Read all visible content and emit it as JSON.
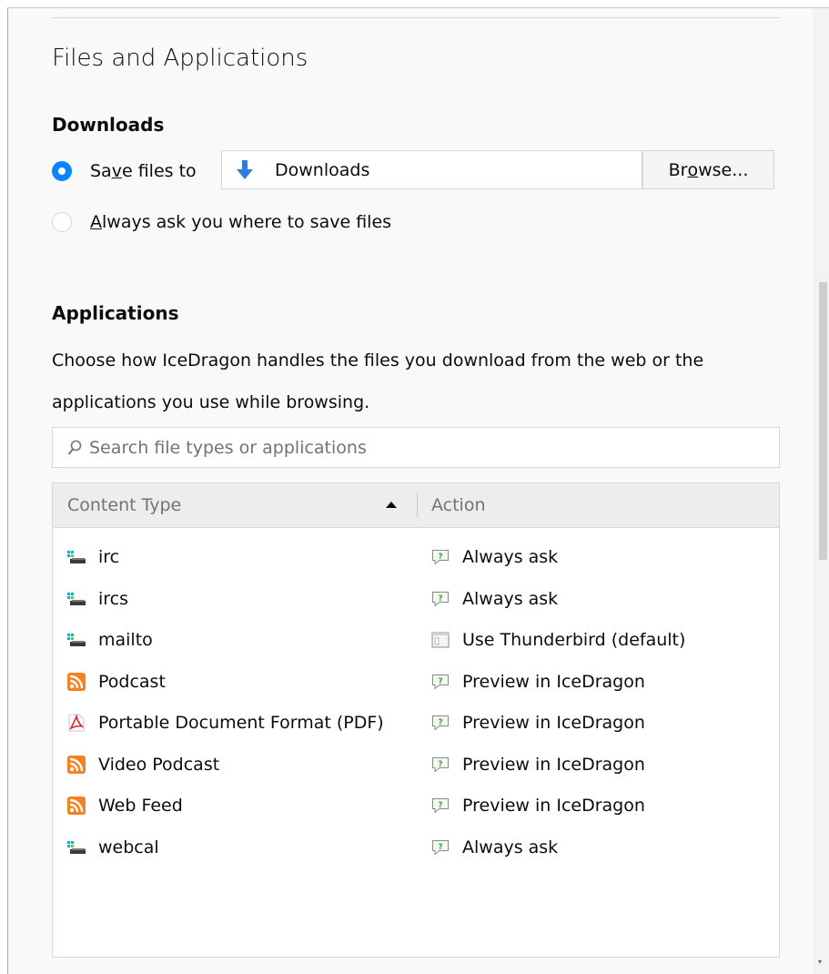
{
  "section_title": "Files and Applications",
  "downloads": {
    "heading": "Downloads",
    "save_option": {
      "pre": "Sa",
      "accel": "v",
      "post": "e files to",
      "checked": true
    },
    "folder_name": "Downloads",
    "browse": {
      "pre": "Br",
      "accel": "o",
      "post": "wse..."
    },
    "ask_option": {
      "accel": "A",
      "post": "lways ask you where to save files",
      "checked": false
    }
  },
  "applications": {
    "heading": "Applications",
    "description_line1": "Choose how IceDragon handles the files you download from the web or the",
    "description_line2": "applications you use while browsing.",
    "search_placeholder": "Search file types or applications",
    "columns": {
      "content_type": "Content Type",
      "action": "Action"
    },
    "rows": [
      {
        "type": "irc",
        "type_icon": "network-icon",
        "action": "Always ask",
        "action_icon": "ask-icon"
      },
      {
        "type": "ircs",
        "type_icon": "network-icon",
        "action": "Always ask",
        "action_icon": "ask-icon"
      },
      {
        "type": "mailto",
        "type_icon": "network-icon",
        "action": "Use Thunderbird (default)",
        "action_icon": "application-icon"
      },
      {
        "type": "Podcast",
        "type_icon": "feed-icon",
        "action": "Preview in IceDragon",
        "action_icon": "ask-icon"
      },
      {
        "type": "Portable Document Format (PDF)",
        "type_icon": "pdf-icon",
        "action": "Preview in IceDragon",
        "action_icon": "ask-icon"
      },
      {
        "type": "Video Podcast",
        "type_icon": "feed-icon",
        "action": "Preview in IceDragon",
        "action_icon": "ask-icon"
      },
      {
        "type": "Web Feed",
        "type_icon": "feed-icon",
        "action": "Preview in IceDragon",
        "action_icon": "ask-icon"
      },
      {
        "type": "webcal",
        "type_icon": "network-icon",
        "action": "Always ask",
        "action_icon": "ask-icon"
      }
    ]
  },
  "colors": {
    "accent": "#0a84ff",
    "feed": "#f58220",
    "pdf": "#d9262c"
  }
}
